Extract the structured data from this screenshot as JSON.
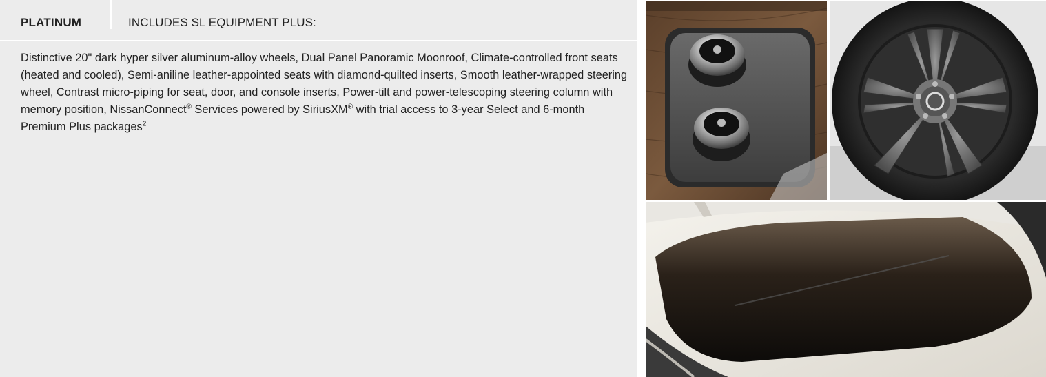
{
  "header": {
    "trim_name": "PLATINUM",
    "includes": "INCLUDES SL EQUIPMENT PLUS:"
  },
  "description": {
    "text": "Distinctive 20\" dark hyper silver aluminum-alloy wheels, Dual Panel Panoramic Moonroof, Climate-controlled front seats (heated and cooled), Semi-aniline leather-appointed seats with diamond-quilted inserts, Smooth leather-wrapped steering wheel, Contrast micro-piping for seat, door, and console inserts, Power-tilt and power-telescoping steering column with memory position, NissanConnect",
    "reg_1": "®",
    "text_mid": " Services powered by SiriusXM",
    "reg_2": "®",
    "text_end": " with trial access to 3-year Select and 6-month Premium Plus packages",
    "footnote": "2"
  },
  "colors": {
    "panel_bg": "#ececec",
    "text": "#222222",
    "divider": "#ffffff"
  },
  "images": [
    {
      "subject": "climate-controlled seat dials on wood console"
    },
    {
      "subject": "20-inch dark hyper silver alloy wheel"
    },
    {
      "subject": "dual panel panoramic moonroof"
    }
  ]
}
